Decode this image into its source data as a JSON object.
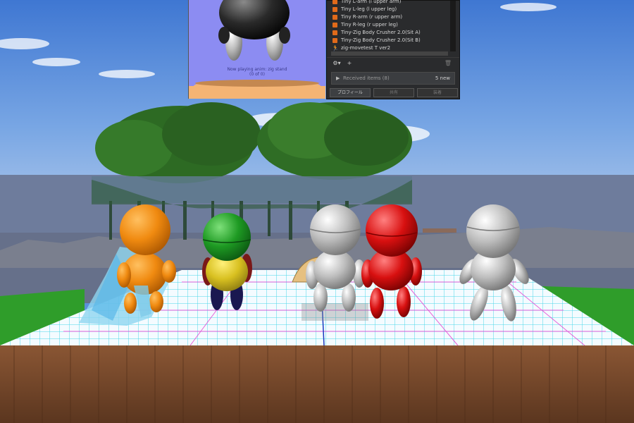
{
  "preview": {
    "caption_line1": "Now playing anim: zig stand",
    "caption_line2": "(0 of 0)"
  },
  "inventory": {
    "items": [
      {
        "label": "Tiny L-arm (l upper arm)",
        "icon": "object-cube-icon"
      },
      {
        "label": "Tiny L-leg (l upper leg)",
        "icon": "object-cube-icon"
      },
      {
        "label": "Tiny R-arm (r upper arm)",
        "icon": "object-cube-icon"
      },
      {
        "label": "Tiny R-leg (r upper leg)",
        "icon": "object-cube-icon"
      },
      {
        "label": "Tiny-Zig Body Crusher 2.0(Sit A)",
        "icon": "object-cube-icon"
      },
      {
        "label": "Tiny-Zig Body Crusher 2.0(Sit B)",
        "icon": "object-cube-icon"
      },
      {
        "label": "zig-movetest T ver2",
        "icon": "animation-icon"
      }
    ],
    "gear_symbol": "⚙▾",
    "plus_symbol": "+",
    "trash_symbol": "🗑",
    "received_arrow": "▶",
    "received_label": "Received items (8)",
    "received_count": "5 new",
    "buttons": [
      {
        "label": "プロフィール",
        "enabled": true
      },
      {
        "label": "共有",
        "enabled": false
      },
      {
        "label": "装着",
        "enabled": false
      }
    ]
  },
  "colors": {
    "sky": "#5b8fd8",
    "grid_platform": "#ffffff",
    "grid_lines": "#33d6e6",
    "grid_magenta": "#e53bd0",
    "wood": "#7b4a2c",
    "grass": "#2f9d2a"
  }
}
